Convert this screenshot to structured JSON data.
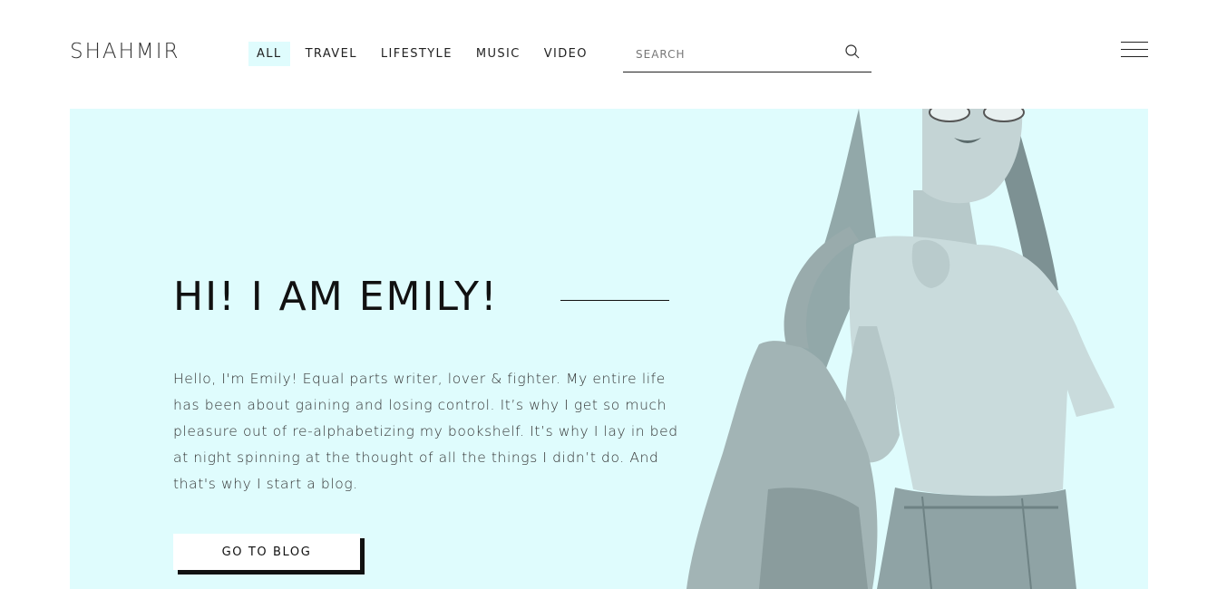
{
  "header": {
    "logo": "SHAHMIR",
    "nav": [
      {
        "label": "ALL",
        "active": true
      },
      {
        "label": "TRAVEL",
        "active": false
      },
      {
        "label": "LIFESTYLE",
        "active": false
      },
      {
        "label": "MUSIC",
        "active": false
      },
      {
        "label": "VIDEO",
        "active": false
      }
    ],
    "search": {
      "placeholder": "SEARCH",
      "value": "",
      "icon": "search-icon"
    },
    "menu_icon": "hamburger-menu-icon"
  },
  "hero": {
    "title": "HI! I AM EMILY!",
    "text": "Hello, I'm Emily! Equal parts writer, lover & fighter. My entire life has been about gaining and losing control. It’s why I get so much pleasure out of re-alphabetizing my bookshelf. It’s why I lay in bed at night spinning at the thought of all the things I didn’t do. And that's why I start a blog.",
    "cta_label": "GO TO BLOG",
    "background_color": "#dffcfd"
  },
  "colors": {
    "accent": "#dffcfd",
    "text": "#111111"
  }
}
